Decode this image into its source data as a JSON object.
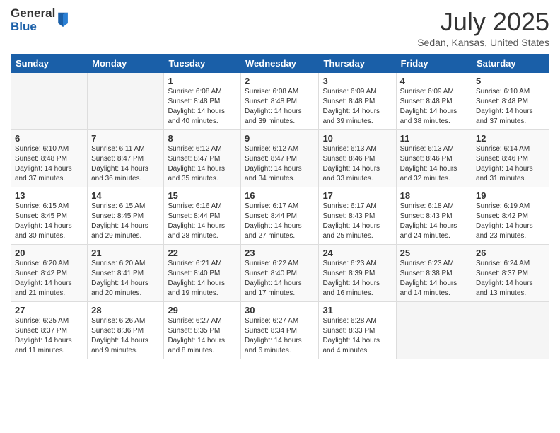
{
  "logo": {
    "general": "General",
    "blue": "Blue"
  },
  "title": "July 2025",
  "location": "Sedan, Kansas, United States",
  "weekdays": [
    "Sunday",
    "Monday",
    "Tuesday",
    "Wednesday",
    "Thursday",
    "Friday",
    "Saturday"
  ],
  "weeks": [
    [
      {
        "day": "",
        "info": ""
      },
      {
        "day": "",
        "info": ""
      },
      {
        "day": "1",
        "info": "Sunrise: 6:08 AM\nSunset: 8:48 PM\nDaylight: 14 hours and 40 minutes."
      },
      {
        "day": "2",
        "info": "Sunrise: 6:08 AM\nSunset: 8:48 PM\nDaylight: 14 hours and 39 minutes."
      },
      {
        "day": "3",
        "info": "Sunrise: 6:09 AM\nSunset: 8:48 PM\nDaylight: 14 hours and 39 minutes."
      },
      {
        "day": "4",
        "info": "Sunrise: 6:09 AM\nSunset: 8:48 PM\nDaylight: 14 hours and 38 minutes."
      },
      {
        "day": "5",
        "info": "Sunrise: 6:10 AM\nSunset: 8:48 PM\nDaylight: 14 hours and 37 minutes."
      }
    ],
    [
      {
        "day": "6",
        "info": "Sunrise: 6:10 AM\nSunset: 8:48 PM\nDaylight: 14 hours and 37 minutes."
      },
      {
        "day": "7",
        "info": "Sunrise: 6:11 AM\nSunset: 8:47 PM\nDaylight: 14 hours and 36 minutes."
      },
      {
        "day": "8",
        "info": "Sunrise: 6:12 AM\nSunset: 8:47 PM\nDaylight: 14 hours and 35 minutes."
      },
      {
        "day": "9",
        "info": "Sunrise: 6:12 AM\nSunset: 8:47 PM\nDaylight: 14 hours and 34 minutes."
      },
      {
        "day": "10",
        "info": "Sunrise: 6:13 AM\nSunset: 8:46 PM\nDaylight: 14 hours and 33 minutes."
      },
      {
        "day": "11",
        "info": "Sunrise: 6:13 AM\nSunset: 8:46 PM\nDaylight: 14 hours and 32 minutes."
      },
      {
        "day": "12",
        "info": "Sunrise: 6:14 AM\nSunset: 8:46 PM\nDaylight: 14 hours and 31 minutes."
      }
    ],
    [
      {
        "day": "13",
        "info": "Sunrise: 6:15 AM\nSunset: 8:45 PM\nDaylight: 14 hours and 30 minutes."
      },
      {
        "day": "14",
        "info": "Sunrise: 6:15 AM\nSunset: 8:45 PM\nDaylight: 14 hours and 29 minutes."
      },
      {
        "day": "15",
        "info": "Sunrise: 6:16 AM\nSunset: 8:44 PM\nDaylight: 14 hours and 28 minutes."
      },
      {
        "day": "16",
        "info": "Sunrise: 6:17 AM\nSunset: 8:44 PM\nDaylight: 14 hours and 27 minutes."
      },
      {
        "day": "17",
        "info": "Sunrise: 6:17 AM\nSunset: 8:43 PM\nDaylight: 14 hours and 25 minutes."
      },
      {
        "day": "18",
        "info": "Sunrise: 6:18 AM\nSunset: 8:43 PM\nDaylight: 14 hours and 24 minutes."
      },
      {
        "day": "19",
        "info": "Sunrise: 6:19 AM\nSunset: 8:42 PM\nDaylight: 14 hours and 23 minutes."
      }
    ],
    [
      {
        "day": "20",
        "info": "Sunrise: 6:20 AM\nSunset: 8:42 PM\nDaylight: 14 hours and 21 minutes."
      },
      {
        "day": "21",
        "info": "Sunrise: 6:20 AM\nSunset: 8:41 PM\nDaylight: 14 hours and 20 minutes."
      },
      {
        "day": "22",
        "info": "Sunrise: 6:21 AM\nSunset: 8:40 PM\nDaylight: 14 hours and 19 minutes."
      },
      {
        "day": "23",
        "info": "Sunrise: 6:22 AM\nSunset: 8:40 PM\nDaylight: 14 hours and 17 minutes."
      },
      {
        "day": "24",
        "info": "Sunrise: 6:23 AM\nSunset: 8:39 PM\nDaylight: 14 hours and 16 minutes."
      },
      {
        "day": "25",
        "info": "Sunrise: 6:23 AM\nSunset: 8:38 PM\nDaylight: 14 hours and 14 minutes."
      },
      {
        "day": "26",
        "info": "Sunrise: 6:24 AM\nSunset: 8:37 PM\nDaylight: 14 hours and 13 minutes."
      }
    ],
    [
      {
        "day": "27",
        "info": "Sunrise: 6:25 AM\nSunset: 8:37 PM\nDaylight: 14 hours and 11 minutes."
      },
      {
        "day": "28",
        "info": "Sunrise: 6:26 AM\nSunset: 8:36 PM\nDaylight: 14 hours and 9 minutes."
      },
      {
        "day": "29",
        "info": "Sunrise: 6:27 AM\nSunset: 8:35 PM\nDaylight: 14 hours and 8 minutes."
      },
      {
        "day": "30",
        "info": "Sunrise: 6:27 AM\nSunset: 8:34 PM\nDaylight: 14 hours and 6 minutes."
      },
      {
        "day": "31",
        "info": "Sunrise: 6:28 AM\nSunset: 8:33 PM\nDaylight: 14 hours and 4 minutes."
      },
      {
        "day": "",
        "info": ""
      },
      {
        "day": "",
        "info": ""
      }
    ]
  ]
}
